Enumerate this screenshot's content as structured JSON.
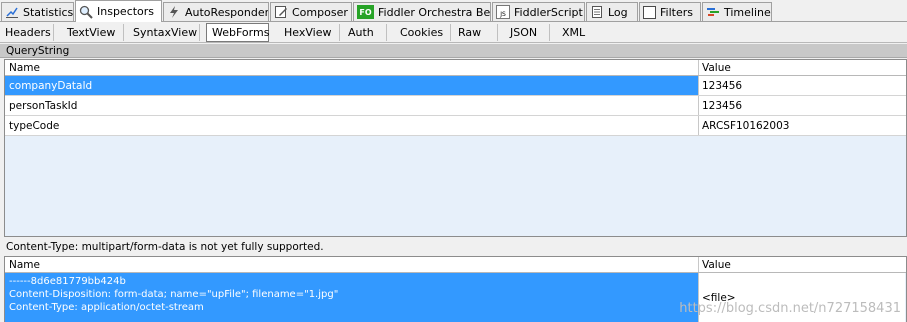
{
  "tabs": [
    {
      "label": "Statistics",
      "icon": "statistics-icon"
    },
    {
      "label": "Inspectors",
      "icon": "inspectors-icon",
      "active": true
    },
    {
      "label": "AutoResponder",
      "icon": "autoresponder-icon"
    },
    {
      "label": "Composer",
      "icon": "composer-icon"
    },
    {
      "label": "Fiddler Orchestra Beta",
      "icon": "fo-icon",
      "icon_text": "FO"
    },
    {
      "label": "FiddlerScript",
      "icon": "fiddlerscript-icon",
      "icon_text": "JS"
    },
    {
      "label": "Log",
      "icon": "log-icon"
    },
    {
      "label": "Filters",
      "icon": "filters-icon"
    },
    {
      "label": "Timeline",
      "icon": "timeline-icon"
    }
  ],
  "subtabs": [
    "Headers",
    "TextView",
    "SyntaxView",
    "WebForms",
    "HexView",
    "Auth",
    "Cookies",
    "Raw",
    "JSON",
    "XML"
  ],
  "active_subtab": "WebForms",
  "querystring": {
    "title": "QueryString",
    "col_name": "Name",
    "col_value": "Value",
    "rows": [
      {
        "name": "companyDataId",
        "value": "123456",
        "selected": true
      },
      {
        "name": "personTaskId",
        "value": "123456"
      },
      {
        "name": "typeCode",
        "value": "ARCSF10162003"
      }
    ]
  },
  "body": {
    "status": "Content-Type: multipart/form-data is not yet fully supported.",
    "col_name": "Name",
    "col_value": "Value",
    "row": {
      "name_lines": [
        "------8d6e81779bb424b",
        "Content-Disposition: form-data; name=\"upFile\"; filename=\"1.jpg\"",
        "Content-Type: application/octet-stream"
      ],
      "value": "<file>"
    }
  },
  "watermark": "https://blog.csdn.net/n727158431",
  "colors": {
    "selection": "#3399ff",
    "empty_area": "#e7f0fa",
    "header_band": "#c8c8c8"
  }
}
